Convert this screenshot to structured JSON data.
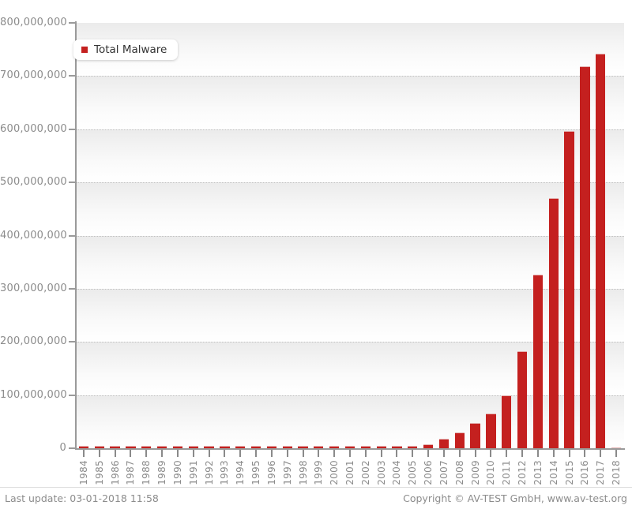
{
  "chart_data": {
    "type": "bar",
    "title": "",
    "xlabel": "",
    "ylabel": "",
    "ylim": [
      0,
      800000000
    ],
    "ytick_values": [
      0,
      100000000,
      200000000,
      300000000,
      400000000,
      500000000,
      600000000,
      700000000,
      800000000
    ],
    "ytick_labels": [
      "0",
      "100,000,000",
      "200,000,000",
      "300,000,000",
      "400,000,000",
      "500,000,000",
      "600,000,000",
      "700,000,000",
      "800,000,000"
    ],
    "grid": true,
    "legend_position": "top-left",
    "series": [
      {
        "name": "Total Malware",
        "color": "#c4201f",
        "values": [
          1000000,
          1000000,
          1000000,
          1000000,
          1000000,
          1000000,
          1000000,
          1000000,
          1000000,
          1000000,
          1000000,
          1000000,
          1000000,
          1000000,
          1000000,
          1000000,
          1000000,
          1500000,
          2000000,
          2500000,
          3000000,
          4000000,
          8000000,
          18000000,
          30000000,
          48000000,
          65000000,
          100000000,
          182000000,
          326000000,
          470000000,
          597000000,
          719000000,
          742000000
        ]
      }
    ],
    "categories": [
      "1984",
      "1985",
      "1986",
      "1987",
      "1988",
      "1989",
      "1990",
      "1991",
      "1992",
      "1993",
      "1994",
      "1995",
      "1996",
      "1997",
      "1998",
      "1999",
      "2000",
      "2001",
      "2002",
      "2003",
      "2004",
      "2005",
      "2006",
      "2007",
      "2008",
      "2009",
      "2010",
      "2011",
      "2012",
      "2013",
      "2014",
      "2015",
      "2016",
      "2017",
      "2018"
    ]
  },
  "legend": {
    "label": "Total Malware",
    "color": "#c4201f"
  },
  "footer": {
    "last_update": "Last update: 03-01-2018 11:58",
    "copyright": "Copyright © AV-TEST GmbH, www.av-test.org"
  }
}
